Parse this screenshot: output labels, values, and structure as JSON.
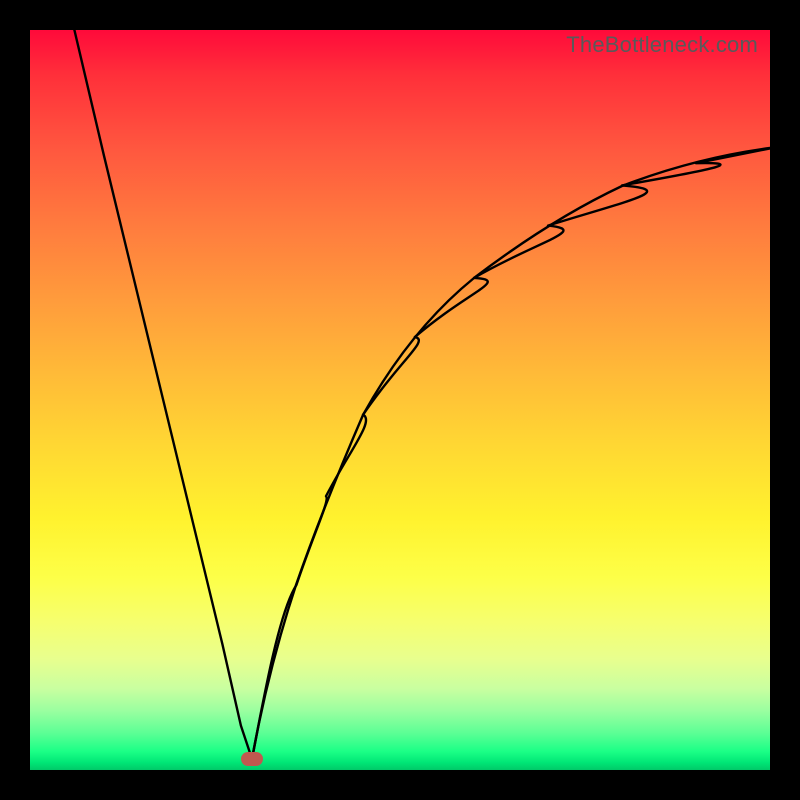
{
  "watermark": {
    "text": "TheBottleneck.com"
  },
  "colors": {
    "background": "#000000",
    "curve": "#000000",
    "marker": "#c0594f",
    "gradient_top": "#ff0a3a",
    "gradient_bottom": "#00c968"
  },
  "chart_data": {
    "type": "line",
    "title": "",
    "xlabel": "",
    "ylabel": "",
    "xlim": [
      0,
      1
    ],
    "ylim": [
      0,
      1
    ],
    "legend": false,
    "grid": false,
    "annotations": [
      {
        "text": "TheBottleneck.com",
        "position": "top-right"
      }
    ],
    "marker": {
      "x": 0.3,
      "y": 0.015,
      "shape": "rounded-rect",
      "color": "#c0594f"
    },
    "series": [
      {
        "name": "left-branch",
        "x": [
          0.06,
          0.1,
          0.14,
          0.18,
          0.22,
          0.26,
          0.285,
          0.3
        ],
        "y": [
          1.0,
          0.83,
          0.665,
          0.5,
          0.335,
          0.17,
          0.06,
          0.015
        ]
      },
      {
        "name": "right-branch",
        "x": [
          0.3,
          0.33,
          0.36,
          0.4,
          0.45,
          0.52,
          0.6,
          0.7,
          0.8,
          0.9,
          1.0
        ],
        "y": [
          0.015,
          0.14,
          0.25,
          0.37,
          0.48,
          0.585,
          0.665,
          0.735,
          0.79,
          0.82,
          0.84
        ]
      }
    ]
  }
}
